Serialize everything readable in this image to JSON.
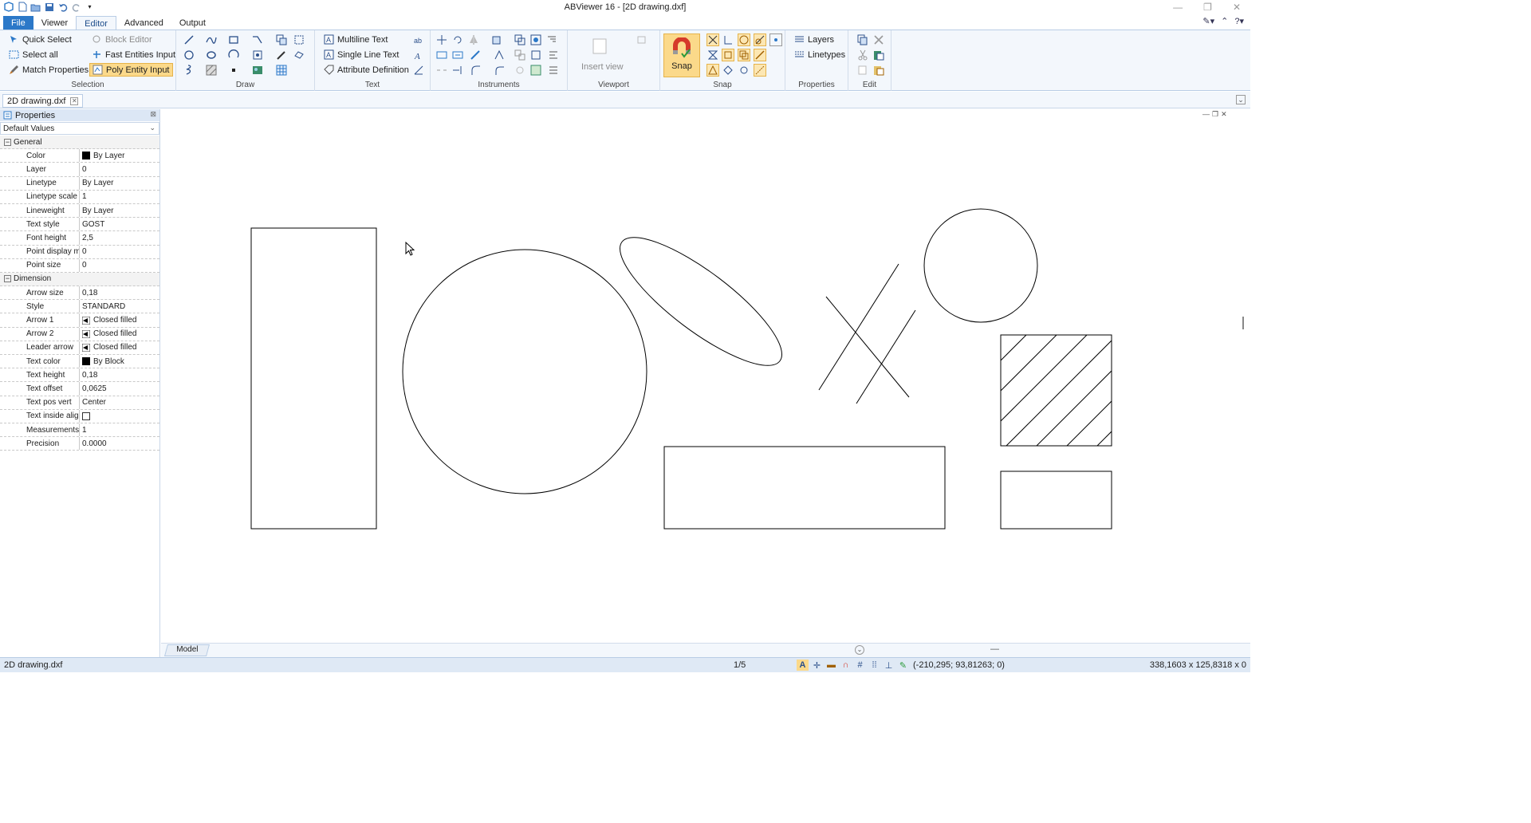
{
  "window": {
    "title": "ABViewer 16 - [2D drawing.dxf]"
  },
  "ribbon_tabs": [
    "File",
    "Viewer",
    "Editor",
    "Advanced",
    "Output"
  ],
  "ribbon": {
    "selection": {
      "label": "Selection",
      "quick_select": "Quick Select",
      "select_all": "Select all",
      "match_properties": "Match Properties",
      "block_editor": "Block Editor",
      "fast_entities": "Fast Entities Input",
      "poly_entity": "Poly Entity Input"
    },
    "draw": {
      "label": "Draw"
    },
    "text": {
      "label": "Text",
      "multiline": "Multiline Text",
      "single_line": "Single Line Text",
      "attribute": "Attribute Definition"
    },
    "instruments": {
      "label": "Instruments"
    },
    "viewport": {
      "label": "Viewport",
      "insert_view": "Insert view"
    },
    "snap": {
      "label": "Snap",
      "snap_button": "Snap"
    },
    "properties": {
      "label": "Properties",
      "layers": "Layers",
      "linetypes": "Linetypes"
    },
    "edit": {
      "label": "Edit"
    }
  },
  "document_tab": "2D drawing.dxf",
  "properties_panel": {
    "title": "Properties",
    "selector": "Default Values",
    "general": {
      "label": "General",
      "rows": [
        {
          "name": "Color",
          "value": "By Layer"
        },
        {
          "name": "Layer",
          "value": "0"
        },
        {
          "name": "Linetype",
          "value": "By Layer"
        },
        {
          "name": "Linetype scale",
          "value": "1"
        },
        {
          "name": "Lineweight",
          "value": "By Layer"
        },
        {
          "name": "Text style",
          "value": "GOST"
        },
        {
          "name": "Font height",
          "value": "2,5"
        },
        {
          "name": "Point display mod",
          "value": "0"
        },
        {
          "name": "Point size",
          "value": "0"
        }
      ]
    },
    "dimension": {
      "label": "Dimension",
      "rows": [
        {
          "name": "Arrow size",
          "value": "0,18"
        },
        {
          "name": "Style",
          "value": "STANDARD"
        },
        {
          "name": "Arrow 1",
          "value": "Closed filled"
        },
        {
          "name": "Arrow 2",
          "value": "Closed filled"
        },
        {
          "name": "Leader arrow",
          "value": "Closed filled"
        },
        {
          "name": "Text color",
          "value": "By Block"
        },
        {
          "name": "Text height",
          "value": "0,18"
        },
        {
          "name": "Text offset",
          "value": "0,0625"
        },
        {
          "name": "Text pos vert",
          "value": "Center"
        },
        {
          "name": "Text inside align",
          "value": ""
        },
        {
          "name": "Measurements sc",
          "value": "1"
        },
        {
          "name": "Precision",
          "value": "0.0000"
        }
      ]
    }
  },
  "layout_tab": "Model",
  "status": {
    "file": "2D drawing.dxf",
    "page": "1/5",
    "coordinates": "(-210,295; 93,81263; 0)",
    "size": "338,1603 x 125,8318 x 0"
  },
  "colors": {
    "accent": "#2b78c8",
    "ribbon_bg": "#f3f7fc",
    "snap_highlight": "#fbd98a"
  }
}
